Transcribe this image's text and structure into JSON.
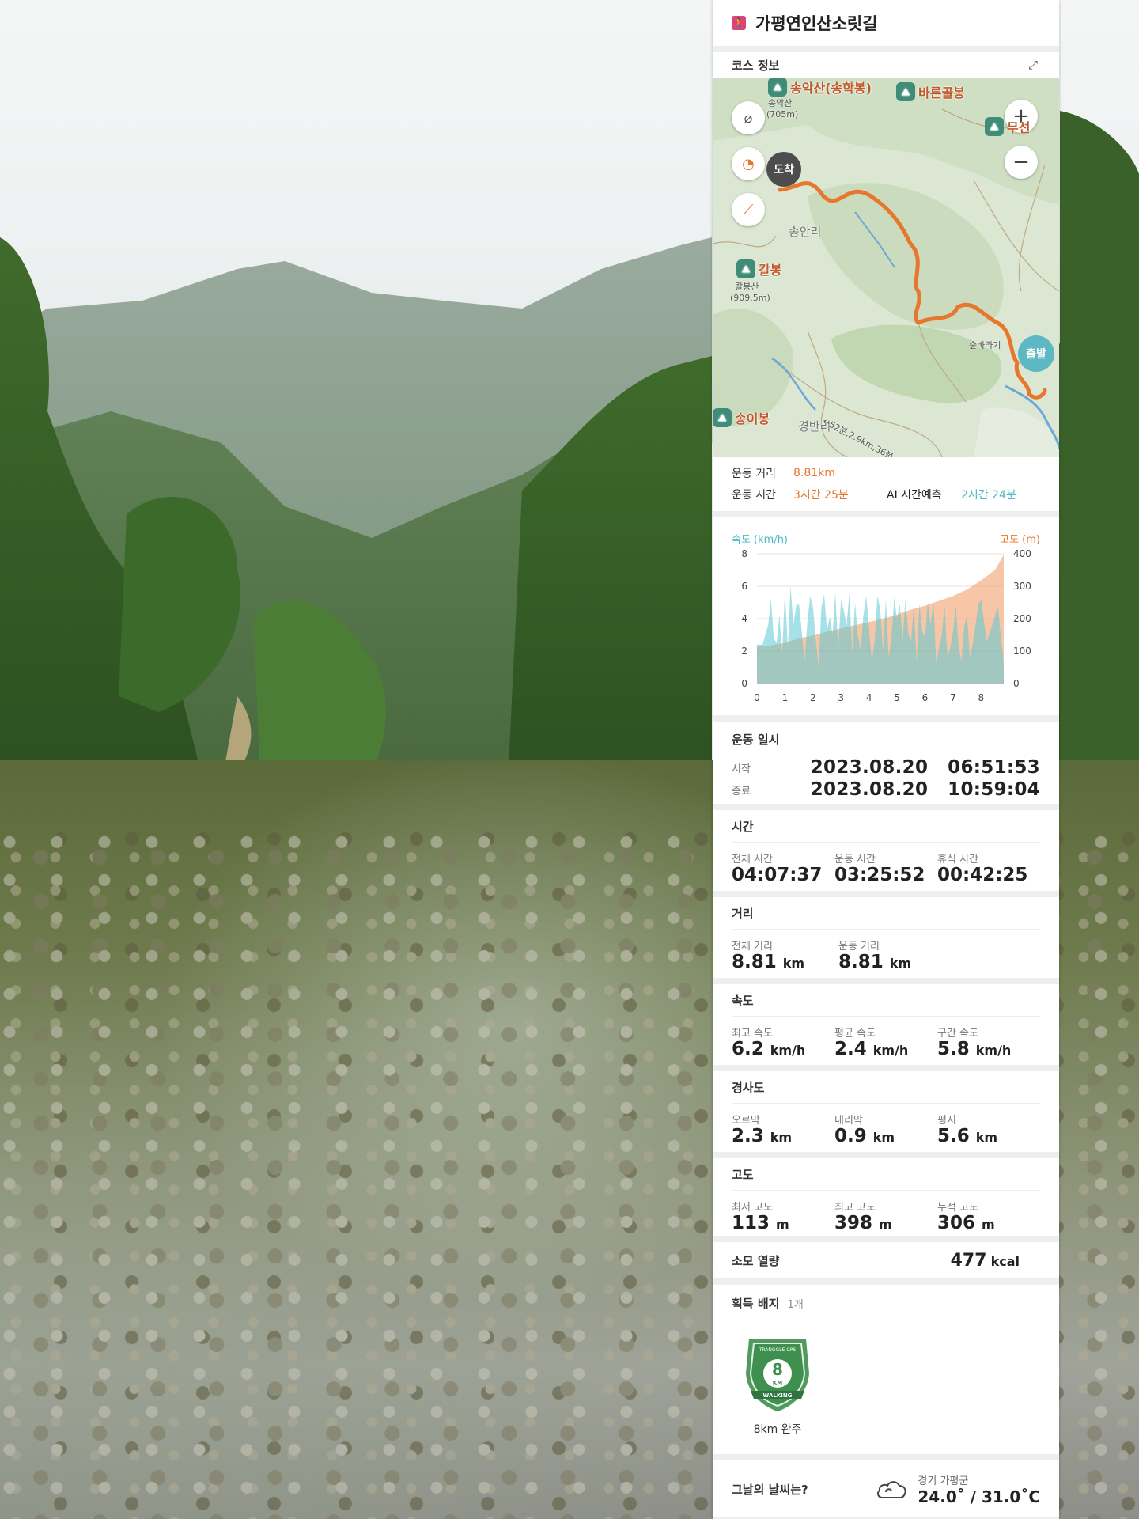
{
  "header": {
    "title": "가평연인산소릿길"
  },
  "course": {
    "title": "코스 정보"
  },
  "map": {
    "end_pin": "도착",
    "start_pin": "출발",
    "peaks": [
      {
        "name": "송악산(송학봉)"
      },
      {
        "name": "바른골봉"
      },
      {
        "name": "무선"
      },
      {
        "name": "칼봉"
      },
      {
        "name": "송이봉"
      }
    ],
    "labels": {
      "songak": "송악산",
      "songak_h": "(705m)",
      "kal": "칼봉산",
      "kal_h": "(909.5m)",
      "village1": "송안리",
      "village2": "경반리",
      "forest": "숲바라기",
      "trail": "←52분,2.9km,36분→"
    },
    "buttons": {
      "zoom_in": "+",
      "zoom_out": "−"
    }
  },
  "summary": {
    "distance_label": "운동 거리",
    "distance_value": "8.81km",
    "time_label": "운동 시간",
    "time_value": "3시간 25분",
    "ai_label": "AI 시간예측",
    "ai_value": "2시간 24분"
  },
  "chart_data": {
    "type": "area",
    "left_axis_label": "속도 (km/h)",
    "right_axis_label": "고도 (m)",
    "x_ticks": [
      "0",
      "1",
      "2",
      "3",
      "4",
      "5",
      "6",
      "7",
      "8"
    ],
    "y_left_ticks": [
      "0",
      "2",
      "4",
      "6",
      "8"
    ],
    "y_right_ticks": [
      "0",
      "100",
      "200",
      "300",
      "400"
    ],
    "xlim": [
      0,
      8.81
    ],
    "ylim_left": [
      0,
      8
    ],
    "ylim_right": [
      0,
      400
    ],
    "series": [
      {
        "name": "속도 (km/h)",
        "color": "#5cc8d3",
        "x": [
          0,
          0.2,
          0.4,
          0.5,
          0.6,
          0.7,
          0.8,
          0.9,
          1.0,
          1.1,
          1.2,
          1.3,
          1.4,
          1.5,
          1.6,
          1.7,
          1.8,
          1.9,
          2.0,
          2.1,
          2.2,
          2.3,
          2.4,
          2.5,
          2.6,
          2.7,
          2.8,
          2.9,
          3.0,
          3.1,
          3.2,
          3.3,
          3.4,
          3.5,
          3.6,
          3.7,
          3.8,
          3.9,
          4.0,
          4.1,
          4.2,
          4.3,
          4.4,
          4.5,
          4.6,
          4.7,
          4.8,
          4.9,
          5.0,
          5.1,
          5.2,
          5.3,
          5.4,
          5.5,
          5.6,
          5.7,
          5.8,
          5.9,
          6.0,
          6.1,
          6.2,
          6.3,
          6.4,
          6.5,
          6.6,
          6.7,
          6.8,
          6.9,
          7.0,
          7.1,
          7.2,
          7.3,
          7.4,
          7.5,
          7.6,
          7.7,
          7.8,
          7.9,
          8.0,
          8.2,
          8.4,
          8.6,
          8.81
        ],
        "y": [
          2.4,
          2.4,
          3.6,
          5.2,
          2.8,
          2.5,
          4.2,
          1.8,
          5.8,
          2.2,
          6.0,
          3.6,
          4.8,
          4.9,
          3.2,
          1.3,
          3.8,
          5.4,
          4.7,
          2.7,
          1.0,
          4.7,
          5.5,
          3.3,
          4.1,
          3.0,
          5.6,
          2.0,
          5.2,
          4.5,
          3.6,
          5.6,
          1.8,
          5.0,
          3.0,
          2.0,
          4.2,
          5.4,
          3.4,
          1.4,
          2.6,
          5.4,
          4.6,
          2.0,
          5.2,
          1.6,
          2.8,
          5.3,
          4.0,
          4.9,
          2.6,
          5.2,
          3.1,
          2.6,
          4.8,
          1.3,
          4.9,
          3.2,
          2.8,
          5.0,
          3.6,
          5.1,
          1.2,
          2.2,
          3.0,
          4.8,
          1.6,
          2.2,
          3.2,
          4.8,
          2.2,
          1.4,
          3.5,
          4.2,
          1.6,
          2.4,
          3.6,
          4.8,
          5.2,
          2.6,
          3.6,
          4.8,
          1.2
        ]
      },
      {
        "name": "고도 (m)",
        "color": "#f0a06a",
        "x": [
          0,
          0.5,
          1,
          1.5,
          2,
          2.5,
          3,
          3.5,
          4,
          4.5,
          5,
          5.5,
          6,
          6.5,
          7,
          7.5,
          8,
          8.5,
          8.81
        ],
        "y": [
          113,
          118,
          125,
          140,
          148,
          160,
          170,
          180,
          190,
          200,
          212,
          228,
          240,
          255,
          270,
          290,
          318,
          350,
          398
        ]
      }
    ]
  },
  "exercise_date": {
    "title": "운동 일시",
    "start_label": "시작",
    "start_value": "2023.08.20   06:51:53",
    "end_label": "종료",
    "end_value": "2023.08.20   10:59:04"
  },
  "time": {
    "title": "시간",
    "items": [
      {
        "label": "전체 시간",
        "value": "04:07:37"
      },
      {
        "label": "운동 시간",
        "value": "03:25:52"
      },
      {
        "label": "휴식 시간",
        "value": "00:42:25"
      }
    ]
  },
  "distance": {
    "title": "거리",
    "items": [
      {
        "label": "전체 거리",
        "value": "8.81",
        "unit": "km"
      },
      {
        "label": "운동 거리",
        "value": "8.81",
        "unit": "km"
      }
    ]
  },
  "speed": {
    "title": "속도",
    "items": [
      {
        "label": "최고 속도",
        "value": "6.2",
        "unit": "km/h"
      },
      {
        "label": "평균 속도",
        "value": "2.4",
        "unit": "km/h"
      },
      {
        "label": "구간 속도",
        "value": "5.8",
        "unit": "km/h"
      }
    ]
  },
  "slope": {
    "title": "경사도",
    "items": [
      {
        "label": "오르막",
        "value": "2.3",
        "unit": "km"
      },
      {
        "label": "내리막",
        "value": "0.9",
        "unit": "km"
      },
      {
        "label": "평지",
        "value": "5.6",
        "unit": "km"
      }
    ]
  },
  "altitude": {
    "title": "고도",
    "items": [
      {
        "label": "최저 고도",
        "value": "113",
        "unit": "m"
      },
      {
        "label": "최고 고도",
        "value": "398",
        "unit": "m"
      },
      {
        "label": "누적 고도",
        "value": "306",
        "unit": "m"
      }
    ]
  },
  "calories": {
    "label": "소모 열량",
    "value": "477",
    "unit": "kcal"
  },
  "badges": {
    "title": "획득 배지",
    "count": "1개",
    "items": [
      {
        "text_top": "TRANGGLE GPS",
        "number": "8",
        "number_unit": "KM",
        "ribbon": "WALKING",
        "label": "8km 완주"
      }
    ]
  },
  "weather": {
    "question": "그날의 날씨는?",
    "location": "경기 가평군",
    "temp": "24.0˚ / 31.0˚C",
    "icon": "cloud-icon"
  },
  "colors": {
    "accent_orange": "#e8772e",
    "accent_teal": "#4bb8c4",
    "walk_icon": "#d9477a",
    "badge_green": "#3f8f4f"
  }
}
